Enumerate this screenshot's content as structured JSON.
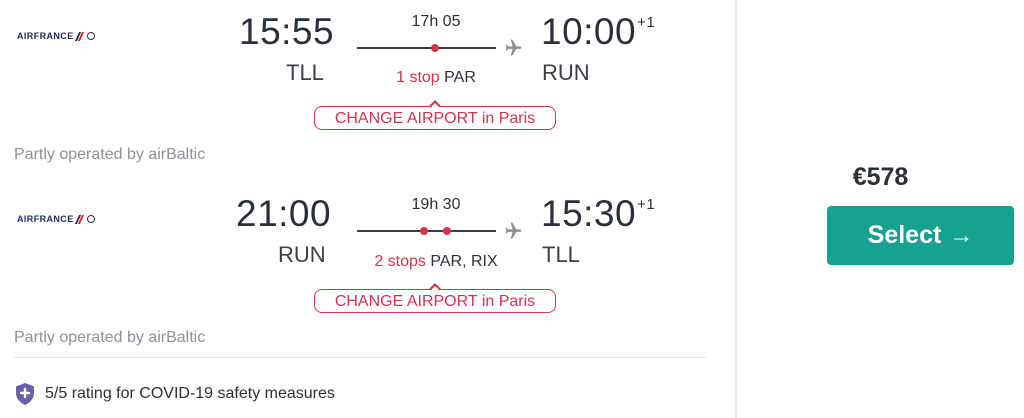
{
  "airline_logo_text": "AIRFRANCE",
  "outbound": {
    "depart_time": "15:55",
    "depart_code": "TLL",
    "duration": "17h 05",
    "arrive_time": "10:00",
    "arrive_day_offset": "+1",
    "arrive_code": "RUN",
    "stops_label": "1 stop",
    "stops_airports": "PAR",
    "change_airport": "CHANGE AIRPORT in Paris",
    "operated_by": "Partly operated by airBaltic"
  },
  "inbound": {
    "depart_time": "21:00",
    "depart_code": "RUN",
    "duration": "19h 30",
    "arrive_time": "15:30",
    "arrive_day_offset": "+1",
    "arrive_code": "TLL",
    "stops_label": "2 stops",
    "stops_airports": "PAR, RIX",
    "change_airport": "CHANGE AIRPORT in Paris",
    "operated_by": "Partly operated by airBaltic"
  },
  "covid_rating": "5/5 rating for COVID-19 safety measures",
  "price": "€578",
  "select_label": "Select",
  "colors": {
    "accent": "#16a190",
    "alert": "#d3334d",
    "shield": "#6b5ea8",
    "text": "#2b2f38",
    "muted": "#8e909a"
  },
  "icons": [
    "airfrance-logo",
    "plane-icon",
    "shield-icon",
    "arrow-right-icon"
  ]
}
